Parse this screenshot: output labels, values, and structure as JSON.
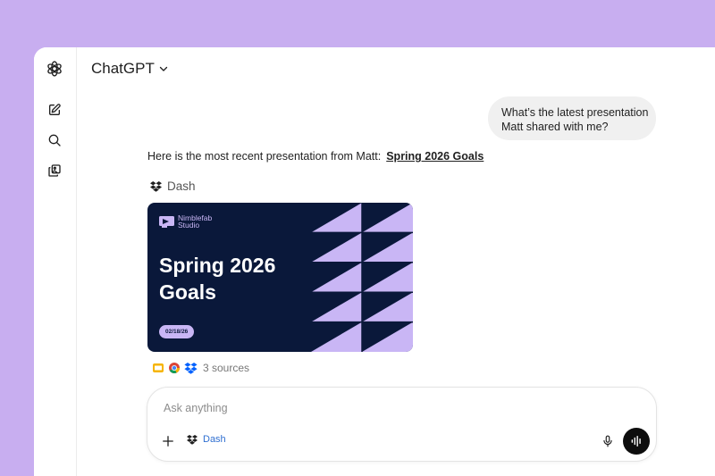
{
  "app": {
    "title": "ChatGPT"
  },
  "sidebar": {
    "items": [
      {
        "icon": "openai-logo-icon"
      },
      {
        "icon": "new-chat-icon"
      },
      {
        "icon": "search-icon"
      },
      {
        "icon": "library-icon"
      }
    ]
  },
  "conversation": {
    "user_message_lines": [
      "What’s the latest presentation",
      "Matt shared with me?"
    ],
    "assistant_text": "Here is the most recent presentation from Matt:",
    "assistant_link": "Spring 2026 Goals",
    "source_label": "Dash",
    "card": {
      "brand_line1": "Nimblefab",
      "brand_line2": "Studio",
      "title_line1": "Spring 2026",
      "title_line2": "Goals",
      "date": "02/18/26"
    },
    "sources_label": "3 sources"
  },
  "composer": {
    "placeholder": "Ask anything",
    "value": "",
    "connector_label": "Dash"
  },
  "colors": {
    "background": "#c8aef0",
    "card_navy": "#0a183a",
    "card_lavender": "#c9b6f5",
    "link_blue": "#2f6fd1"
  }
}
